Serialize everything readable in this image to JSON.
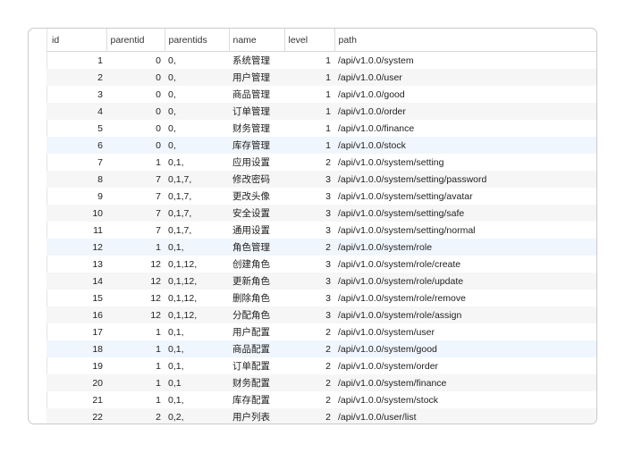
{
  "columns": {
    "id": "id",
    "parentid": "parentid",
    "parentids": "parentids",
    "name": "name",
    "level": "level",
    "path": "path"
  },
  "rows": [
    {
      "id": "1",
      "parentid": "0",
      "parentids": "0,",
      "name": "系统管理",
      "level": "1",
      "path": "/api/v1.0.0/system"
    },
    {
      "id": "2",
      "parentid": "0",
      "parentids": "0,",
      "name": "用户管理",
      "level": "1",
      "path": "/api/v1.0.0/user"
    },
    {
      "id": "3",
      "parentid": "0",
      "parentids": "0,",
      "name": "商品管理",
      "level": "1",
      "path": "/api/v1.0.0/good"
    },
    {
      "id": "4",
      "parentid": "0",
      "parentids": "0,",
      "name": "订单管理",
      "level": "1",
      "path": "/api/v1.0.0/order"
    },
    {
      "id": "5",
      "parentid": "0",
      "parentids": "0,",
      "name": "财务管理",
      "level": "1",
      "path": "/api/v1.0.0/finance"
    },
    {
      "id": "6",
      "parentid": "0",
      "parentids": "0,",
      "name": "库存管理",
      "level": "1",
      "path": "/api/v1.0.0/stock"
    },
    {
      "id": "7",
      "parentid": "1",
      "parentids": "0,1,",
      "name": "应用设置",
      "level": "2",
      "path": "/api/v1.0.0/system/setting"
    },
    {
      "id": "8",
      "parentid": "7",
      "parentids": "0,1,7,",
      "name": "修改密码",
      "level": "3",
      "path": "/api/v1.0.0/system/setting/password"
    },
    {
      "id": "9",
      "parentid": "7",
      "parentids": "0,1,7,",
      "name": "更改头像",
      "level": "3",
      "path": "/api/v1.0.0/system/setting/avatar"
    },
    {
      "id": "10",
      "parentid": "7",
      "parentids": "0,1,7,",
      "name": "安全设置",
      "level": "3",
      "path": "/api/v1.0.0/system/setting/safe"
    },
    {
      "id": "11",
      "parentid": "7",
      "parentids": "0,1,7,",
      "name": "通用设置",
      "level": "3",
      "path": "/api/v1.0.0/system/setting/normal"
    },
    {
      "id": "12",
      "parentid": "1",
      "parentids": "0,1,",
      "name": "角色管理",
      "level": "2",
      "path": "/api/v1.0.0/system/role"
    },
    {
      "id": "13",
      "parentid": "12",
      "parentids": "0,1,12,",
      "name": "创建角色",
      "level": "3",
      "path": "/api/v1.0.0/system/role/create"
    },
    {
      "id": "14",
      "parentid": "12",
      "parentids": "0,1,12,",
      "name": "更新角色",
      "level": "3",
      "path": "/api/v1.0.0/system/role/update"
    },
    {
      "id": "15",
      "parentid": "12",
      "parentids": "0,1,12,",
      "name": "删除角色",
      "level": "3",
      "path": "/api/v1.0.0/system/role/remove"
    },
    {
      "id": "16",
      "parentid": "12",
      "parentids": "0,1,12,",
      "name": "分配角色",
      "level": "3",
      "path": "/api/v1.0.0/system/role/assign"
    },
    {
      "id": "17",
      "parentid": "1",
      "parentids": "0,1,",
      "name": "用户配置",
      "level": "2",
      "path": "/api/v1.0.0/system/user"
    },
    {
      "id": "18",
      "parentid": "1",
      "parentids": "0,1,",
      "name": "商品配置",
      "level": "2",
      "path": "/api/v1.0.0/system/good"
    },
    {
      "id": "19",
      "parentid": "1",
      "parentids": "0,1,",
      "name": "订单配置",
      "level": "2",
      "path": "/api/v1.0.0/system/order"
    },
    {
      "id": "20",
      "parentid": "1",
      "parentids": "0,1",
      "name": "财务配置",
      "level": "2",
      "path": "/api/v1.0.0/system/finance"
    },
    {
      "id": "21",
      "parentid": "1",
      "parentids": "0,1,",
      "name": "库存配置",
      "level": "2",
      "path": "/api/v1.0.0/system/stock"
    },
    {
      "id": "22",
      "parentid": "2",
      "parentids": "0,2,",
      "name": "用户列表",
      "level": "2",
      "path": "/api/v1.0.0/user/list"
    }
  ],
  "highlighted_rows": [
    "6",
    "12",
    "18"
  ],
  "colors": {
    "border": "#c9c9c9",
    "stripe": "#f6f6f6",
    "highlight": "#f0f6fd"
  }
}
